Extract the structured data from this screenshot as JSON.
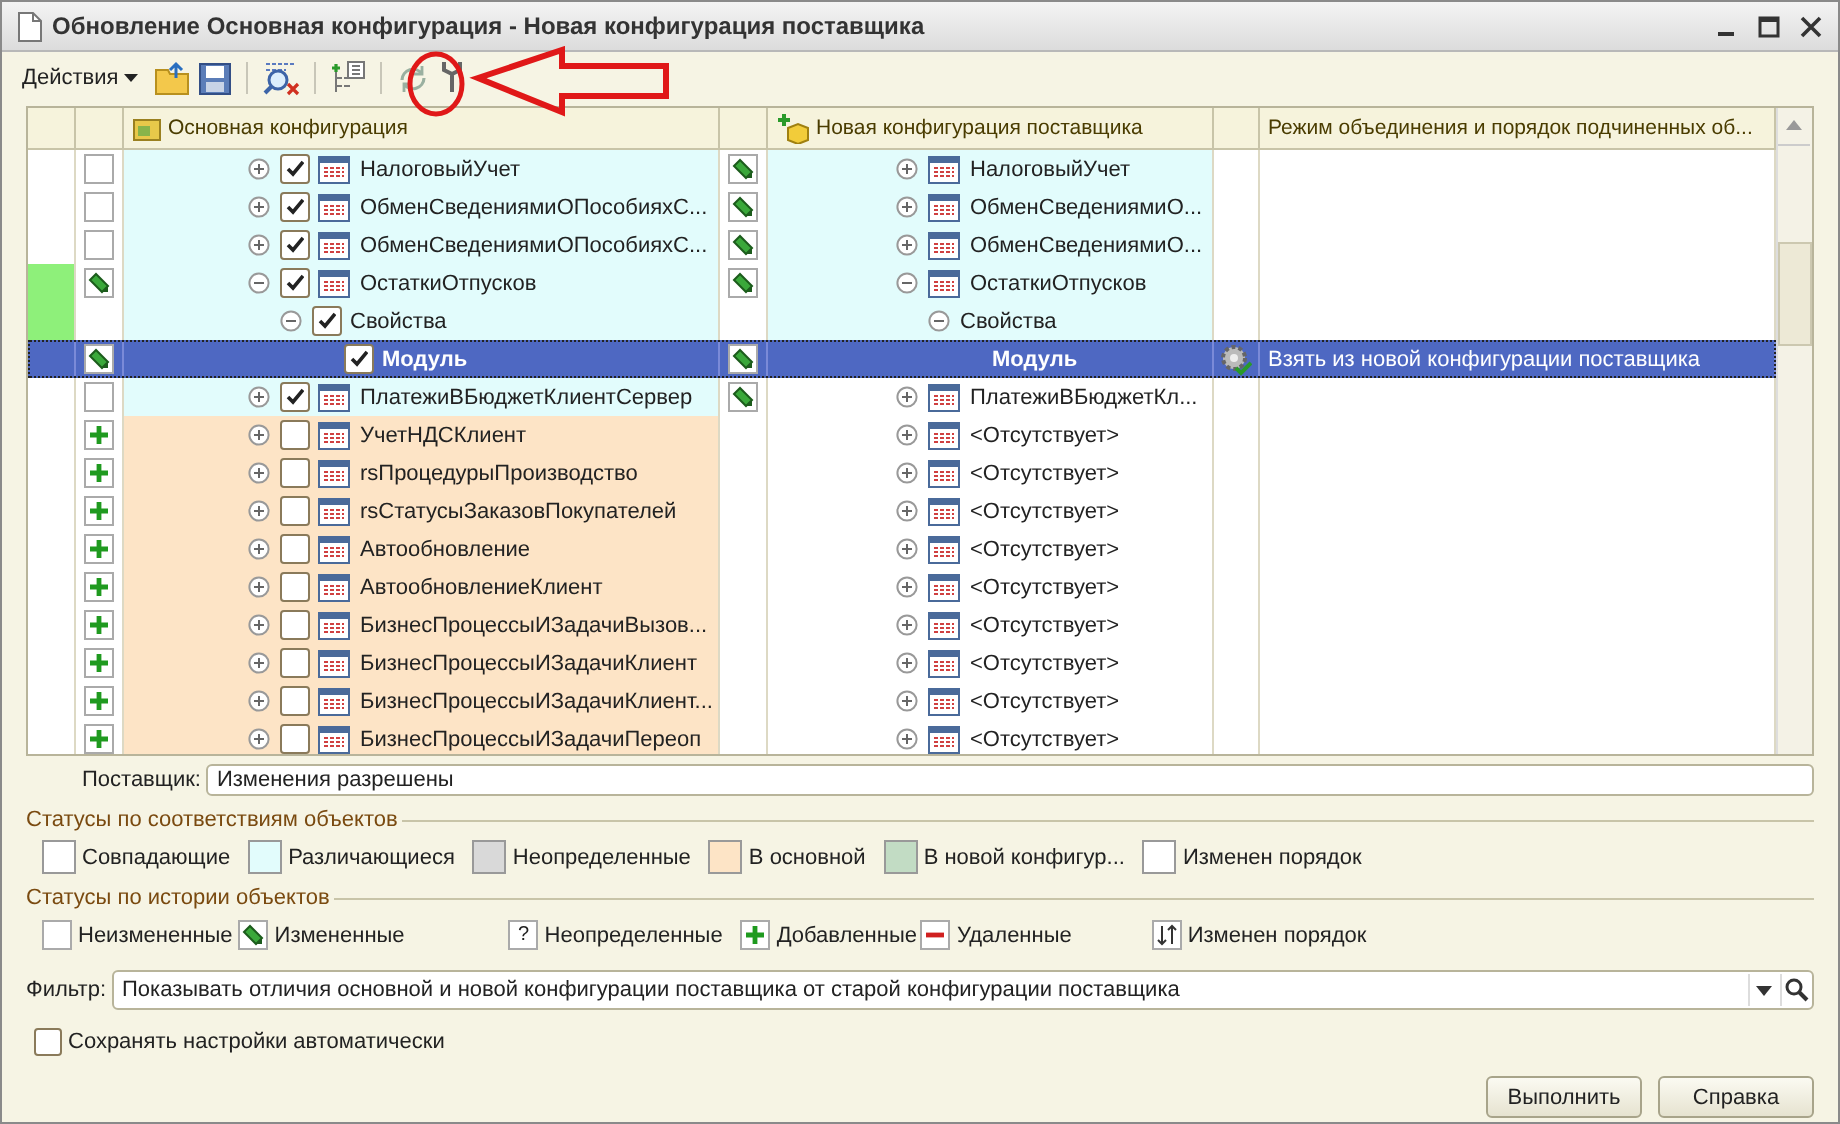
{
  "window": {
    "title": "Обновление Основная конфигурация - Новая конфигурация поставщика"
  },
  "toolbar": {
    "actions_label": "Действия"
  },
  "grid": {
    "columns": [
      "Основная конфигурация",
      "Новая конфигурация поставщика",
      "Режим объединения и порядок подчиненных об..."
    ],
    "rows": [
      {
        "kind": "unchanged",
        "color": "#e2fcfc",
        "new_differs": true,
        "marked": false,
        "selected": false,
        "expanded": false,
        "checked": true,
        "icon": true,
        "name": "НалоговыйУчет",
        "edited": true,
        "new_name": "НалоговыйУчет"
      },
      {
        "kind": "unchanged",
        "color": "#e2fcfc",
        "new_differs": true,
        "marked": false,
        "selected": false,
        "expanded": false,
        "checked": true,
        "icon": true,
        "name": "ОбменСведениямиОПособияхС...",
        "edited": true,
        "new_name": "ОбменСведениямиО..."
      },
      {
        "kind": "unchanged",
        "color": "#e2fcfc",
        "new_differs": true,
        "marked": false,
        "selected": false,
        "expanded": false,
        "checked": true,
        "icon": true,
        "name": "ОбменСведениямиОПособияхС...",
        "edited": true,
        "new_name": "ОбменСведениямиО..."
      },
      {
        "kind": "edited",
        "color": "#e2fcfc",
        "new_differs": true,
        "marked": true,
        "selected": false,
        "expanded": true,
        "checked": true,
        "icon": true,
        "name": "ОстаткиОтпусков",
        "edited": true,
        "new_name": "ОстаткиОтпусков",
        "children": [
          {
            "color": "#e2fcfc",
            "new_differs": true,
            "marked": true,
            "selected": false,
            "expanded": true,
            "checked": true,
            "icon": false,
            "name": "Свойства",
            "edited": false,
            "new_name": "Свойства",
            "children": [
              {
                "kind": "edited",
                "marked": false,
                "selected": true,
                "checked": true,
                "icon": false,
                "name": "Модуль",
                "edited": true,
                "new_name": "Модуль",
                "mode": "Взять из новой конфигурации поставщика"
              }
            ]
          }
        ]
      },
      {
        "kind": "unchanged",
        "color": "#e2fcfc",
        "new_differs": false,
        "marked": false,
        "selected": false,
        "expanded": false,
        "checked": true,
        "icon": true,
        "name": "ПлатежиВБюджетКлиентСервер",
        "edited": true,
        "new_name": "ПлатежиВБюджетКл..."
      },
      {
        "kind": "added",
        "color": "#fde4c6",
        "new_differs": false,
        "marked": false,
        "selected": false,
        "expanded": false,
        "checked": false,
        "icon": true,
        "name": "УчетНДСКлиент",
        "edited": false,
        "new_name": "<Отсутствует>"
      },
      {
        "kind": "added",
        "color": "#fde4c6",
        "new_differs": false,
        "marked": false,
        "selected": false,
        "expanded": false,
        "checked": false,
        "icon": true,
        "name": "rsПроцедурыПроизводство",
        "edited": false,
        "new_name": "<Отсутствует>"
      },
      {
        "kind": "added",
        "color": "#fde4c6",
        "new_differs": false,
        "marked": false,
        "selected": false,
        "expanded": false,
        "checked": false,
        "icon": true,
        "name": "rsСтатусыЗаказовПокупателей",
        "edited": false,
        "new_name": "<Отсутствует>"
      },
      {
        "kind": "added",
        "color": "#fde4c6",
        "new_differs": false,
        "marked": false,
        "selected": false,
        "expanded": false,
        "checked": false,
        "icon": true,
        "name": "Автообновление",
        "edited": false,
        "new_name": "<Отсутствует>"
      },
      {
        "kind": "added",
        "color": "#fde4c6",
        "new_differs": false,
        "marked": false,
        "selected": false,
        "expanded": false,
        "checked": false,
        "icon": true,
        "name": "АвтообновлениеКлиент",
        "edited": false,
        "new_name": "<Отсутствует>"
      },
      {
        "kind": "added",
        "color": "#fde4c6",
        "new_differs": false,
        "marked": false,
        "selected": false,
        "expanded": false,
        "checked": false,
        "icon": true,
        "name": "БизнесПроцессыИЗадачиВызов...",
        "edited": false,
        "new_name": "<Отсутствует>"
      },
      {
        "kind": "added",
        "color": "#fde4c6",
        "new_differs": false,
        "marked": false,
        "selected": false,
        "expanded": false,
        "checked": false,
        "icon": true,
        "name": "БизнесПроцессыИЗадачиКлиент",
        "edited": false,
        "new_name": "<Отсутствует>"
      },
      {
        "kind": "added",
        "color": "#fde4c6",
        "new_differs": false,
        "marked": false,
        "selected": false,
        "expanded": false,
        "checked": false,
        "icon": true,
        "name": "БизнесПроцессыИЗадачиКлиент...",
        "edited": false,
        "new_name": "<Отсутствует>"
      },
      {
        "kind": "added",
        "color": "#fde4c6",
        "new_differs": false,
        "marked": false,
        "selected": false,
        "expanded": false,
        "checked": false,
        "icon": true,
        "name": "БизнесПроцессыИЗадачиПереоп",
        "edited": false,
        "new_name": "<Отсутствует>"
      }
    ]
  },
  "supplier": {
    "label": "Поставщик:",
    "value": "Изменения разрешены"
  },
  "match_legend": {
    "title": "Статусы по соответствиям объектов",
    "items": [
      {
        "label": "Совпадающие",
        "color": "#ffffff"
      },
      {
        "label": "Различающиеся",
        "color": "#e2fcfc"
      },
      {
        "label": "Неопределенные",
        "color": "#d9d9d9"
      },
      {
        "label": "В основной",
        "color": "#fde4c6"
      },
      {
        "label": "В новой конфигур...",
        "color": "#c2dcc4"
      },
      {
        "label": "Изменен порядок",
        "color": "#ffffff"
      }
    ]
  },
  "history_legend": {
    "title": "Статусы по истории объектов",
    "items": [
      {
        "kind": "unchanged",
        "label": "Неизмененные"
      },
      {
        "kind": "edited",
        "label": "Измененные"
      },
      {
        "kind": "unknown",
        "symbol": "?",
        "label": "Неопределенные"
      },
      {
        "kind": "added",
        "label": "Добавленные"
      },
      {
        "kind": "deleted",
        "label": "Удаленные"
      },
      {
        "kind": "reorder",
        "label": "Изменен порядок"
      }
    ]
  },
  "filter": {
    "label": "Фильтр:",
    "value": "Показывать отличия основной и новой конфигурации поставщика от старой конфигурации поставщика"
  },
  "autosave": {
    "label": "Сохранять настройки автоматически",
    "checked": false
  },
  "buttons": [
    "Выполнить",
    "Справка"
  ]
}
